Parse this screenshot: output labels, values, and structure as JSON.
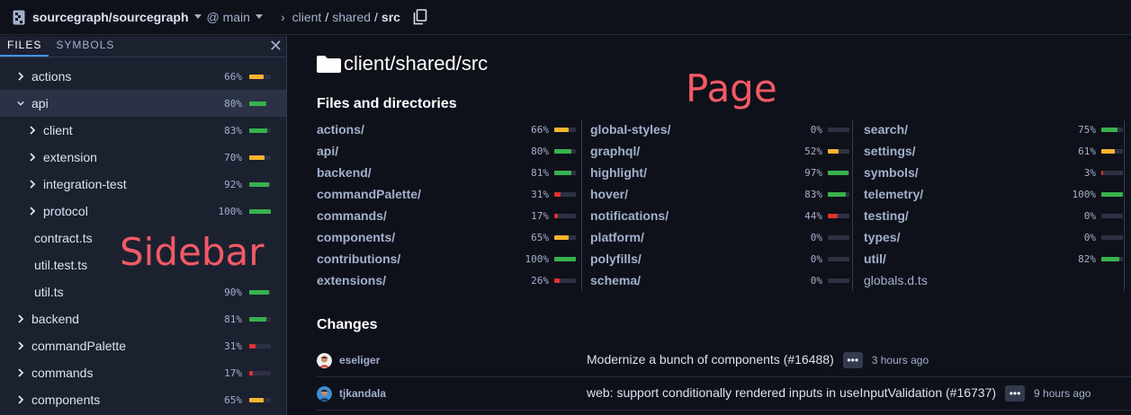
{
  "topbar": {
    "repo": "sourcegraph/sourcegraph",
    "revision": "@ main",
    "path": [
      "client",
      "shared"
    ],
    "path_last": "src"
  },
  "sidebar": {
    "tabs": [
      "FILES",
      "SYMBOLS"
    ],
    "close": "✕",
    "items": [
      {
        "name": "actions",
        "pct": "66%",
        "coverage": 0.66,
        "color": "#f5b431",
        "folder": true,
        "expanded": false,
        "depth": 0
      },
      {
        "name": "api",
        "pct": "80%",
        "coverage": 0.8,
        "color": "#37b24d",
        "folder": true,
        "expanded": true,
        "depth": 0,
        "selected": true
      },
      {
        "name": "client",
        "pct": "83%",
        "coverage": 0.83,
        "color": "#37b24d",
        "folder": true,
        "expanded": false,
        "depth": 1
      },
      {
        "name": "extension",
        "pct": "70%",
        "coverage": 0.7,
        "color": "#f5b431",
        "folder": true,
        "expanded": false,
        "depth": 1
      },
      {
        "name": "integration-test",
        "pct": "92%",
        "coverage": 0.92,
        "color": "#37b24d",
        "folder": true,
        "expanded": false,
        "depth": 1
      },
      {
        "name": "protocol",
        "pct": "100%",
        "coverage": 1.0,
        "color": "#37b24d",
        "folder": true,
        "expanded": false,
        "depth": 1
      },
      {
        "name": "contract.ts",
        "pct": "",
        "coverage": null,
        "color": "",
        "folder": false,
        "depth": 1
      },
      {
        "name": "util.test.ts",
        "pct": "",
        "coverage": null,
        "color": "",
        "folder": false,
        "depth": 1
      },
      {
        "name": "util.ts",
        "pct": "90%",
        "coverage": 0.9,
        "color": "#37b24d",
        "folder": false,
        "depth": 1
      },
      {
        "name": "backend",
        "pct": "81%",
        "coverage": 0.81,
        "color": "#37b24d",
        "folder": true,
        "expanded": false,
        "depth": 0
      },
      {
        "name": "commandPalette",
        "pct": "31%",
        "coverage": 0.31,
        "color": "#e03131",
        "folder": true,
        "expanded": false,
        "depth": 0
      },
      {
        "name": "commands",
        "pct": "17%",
        "coverage": 0.17,
        "color": "#e03131",
        "folder": true,
        "expanded": false,
        "depth": 0
      },
      {
        "name": "components",
        "pct": "65%",
        "coverage": 0.65,
        "color": "#f5b431",
        "folder": true,
        "expanded": false,
        "depth": 0
      }
    ]
  },
  "overlay": {
    "sidebar_label": "Sidebar",
    "page_label": "Page"
  },
  "main": {
    "heading": "client/shared/src",
    "files_title": "Files and directories",
    "columns": [
      [
        {
          "name": "actions/",
          "pct": "66%",
          "coverage": 0.66,
          "color": "#f5b431"
        },
        {
          "name": "api/",
          "pct": "80%",
          "coverage": 0.8,
          "color": "#37b24d"
        },
        {
          "name": "backend/",
          "pct": "81%",
          "coverage": 0.81,
          "color": "#37b24d"
        },
        {
          "name": "commandPalette/",
          "pct": "31%",
          "coverage": 0.31,
          "color": "#e03131"
        },
        {
          "name": "commands/",
          "pct": "17%",
          "coverage": 0.17,
          "color": "#e03131"
        },
        {
          "name": "components/",
          "pct": "65%",
          "coverage": 0.65,
          "color": "#f5b431"
        },
        {
          "name": "contributions/",
          "pct": "100%",
          "coverage": 1.0,
          "color": "#37b24d"
        },
        {
          "name": "extensions/",
          "pct": "26%",
          "coverage": 0.26,
          "color": "#e03131"
        }
      ],
      [
        {
          "name": "global-styles/",
          "pct": "0%",
          "coverage": 0.0,
          "color": "#e03131"
        },
        {
          "name": "graphql/",
          "pct": "52%",
          "coverage": 0.52,
          "color": "#f5b431"
        },
        {
          "name": "highlight/",
          "pct": "97%",
          "coverage": 0.97,
          "color": "#37b24d"
        },
        {
          "name": "hover/",
          "pct": "83%",
          "coverage": 0.83,
          "color": "#37b24d"
        },
        {
          "name": "notifications/",
          "pct": "44%",
          "coverage": 0.44,
          "color": "#e03131"
        },
        {
          "name": "platform/",
          "pct": "0%",
          "coverage": 0.0,
          "color": "#e03131"
        },
        {
          "name": "polyfills/",
          "pct": "0%",
          "coverage": 0.0,
          "color": "#e03131"
        },
        {
          "name": "schema/",
          "pct": "0%",
          "coverage": 0.0,
          "color": "#e03131"
        }
      ],
      [
        {
          "name": "search/",
          "pct": "75%",
          "coverage": 0.75,
          "color": "#37b24d"
        },
        {
          "name": "settings/",
          "pct": "61%",
          "coverage": 0.61,
          "color": "#f5b431"
        },
        {
          "name": "symbols/",
          "pct": "3%",
          "coverage": 0.03,
          "color": "#e03131"
        },
        {
          "name": "telemetry/",
          "pct": "100%",
          "coverage": 1.0,
          "color": "#37b24d"
        },
        {
          "name": "testing/",
          "pct": "0%",
          "coverage": 0.0,
          "color": "#e03131"
        },
        {
          "name": "types/",
          "pct": "0%",
          "coverage": 0.0,
          "color": "#e03131"
        },
        {
          "name": "util/",
          "pct": "82%",
          "coverage": 0.82,
          "color": "#37b24d"
        },
        {
          "name": "globals.d.ts",
          "pct": "",
          "coverage": null,
          "color": "",
          "plain": true
        }
      ]
    ],
    "changes_title": "Changes",
    "changes": [
      {
        "author": "eseliger",
        "message": "Modernize a bunch of components (#16488)",
        "more": "•••",
        "time": "3 hours ago"
      },
      {
        "author": "tjkandala",
        "message": "web: support conditionally rendered inputs in useInputValidation (#16737)",
        "more": "•••",
        "time": "9 hours ago"
      }
    ]
  }
}
